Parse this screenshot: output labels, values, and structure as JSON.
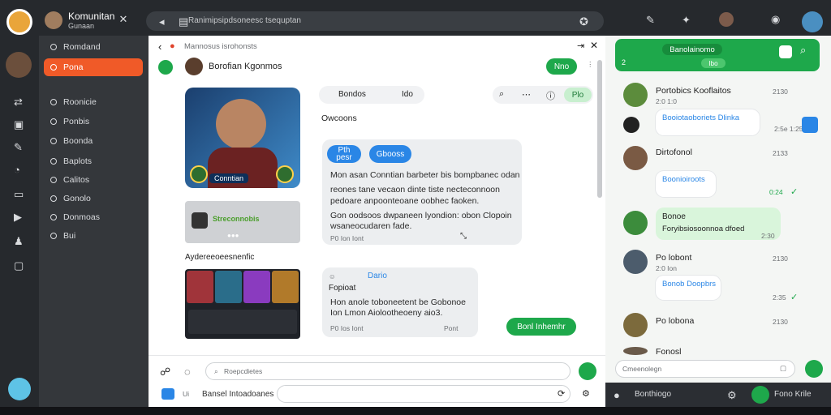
{
  "window": {
    "title": "Komunitan",
    "subtitle": "Gunaan",
    "address": "Ranimipsipdsoneesc tsequptan"
  },
  "sidebar": {
    "items": [
      {
        "label": "Romdand",
        "active": false
      },
      {
        "label": "Pona",
        "active": true
      },
      {
        "label": "Roonicie",
        "active": false
      },
      {
        "label": "Ponbis",
        "active": false
      },
      {
        "label": "Boonda",
        "active": false
      },
      {
        "label": "Baplots",
        "active": false
      },
      {
        "label": "Calitos",
        "active": false
      },
      {
        "label": "Gonolo",
        "active": false
      },
      {
        "label": "Donmoas",
        "active": false
      },
      {
        "label": "Bui",
        "active": false
      }
    ]
  },
  "chat": {
    "breadcrumb": "Mannosus isrohonsts",
    "contact_name": "Borofian Kgonmos",
    "header_button": "Nno",
    "profile_caption": "Conntian",
    "tabs": [
      "Bondos",
      "Ido"
    ],
    "tab_active_pill": "Plo",
    "section_label": "Owcoons",
    "gallery_label": "Aydereeoeesnenfic",
    "chip1_line1": "Pth",
    "chip1_line2": "pesr",
    "chip2": "Gbooss",
    "message1": [
      "Mon asan Conntian barbeter bis bompbanec odan",
      "reones tane vecaon dinte tiste necteconnoon",
      "pedoare anpoonteoane oobhec faoken.",
      "Gon oodsoos dwpaneen lyondion: obon Clopoin",
      "wsaneocudaren fade."
    ],
    "message1_time": "P0  Ion  Iont",
    "message2_header": "Dario",
    "message2_sub": "Fopioat",
    "message2": [
      "Hon anole toboneetent be Gobonoe",
      "Ion Lmon Aiolootheoeny aio3."
    ],
    "message2_time": "P0  Ios  Iont",
    "message2_time_right": "Pont",
    "send_button": "Bonl Inhemhr",
    "banner_text": "Streconnobis",
    "compose_placeholder": "Roepcdietes",
    "footer_label": "Bansel Intoadoanes",
    "footer_prefix": "Ui"
  },
  "right": {
    "header_button": "Banolainomo",
    "header_sub": "Ibo",
    "header_num": "2",
    "contacts": [
      {
        "name": "Portobics Kooflaitos",
        "time": "2130",
        "sub": "2:0  1:0",
        "message": "Booiotaoboriets Dlinka",
        "msg_time": "2:5e  1:25"
      },
      {
        "name": "Dirtofonol",
        "time": "2133",
        "sub": "",
        "message": "Boonioiroots",
        "msg_time": "0:24"
      },
      {
        "name": "Bonoe",
        "time": "",
        "sub": "",
        "message": "Foryibsiosoonnoa dfoed",
        "msg_time": "2:30"
      },
      {
        "name": "Po lobont",
        "time": "2130",
        "sub": "2:0  Ion",
        "message": "Bonob Doopbrs",
        "msg_time": "2:35"
      },
      {
        "name": "Po lobona",
        "time": "2130",
        "sub": "",
        "message": "",
        "msg_time": ""
      },
      {
        "name": "Fonosl",
        "time": "",
        "sub": "",
        "message": "",
        "msg_time": ""
      }
    ],
    "search_placeholder": "Cmeenolegn",
    "footer_label": "Bonthiogo",
    "footer_user": "Fono  Krile"
  },
  "colors": {
    "accent": "#f05a28",
    "green": "#1ea84b",
    "blue": "#2a86e6"
  }
}
